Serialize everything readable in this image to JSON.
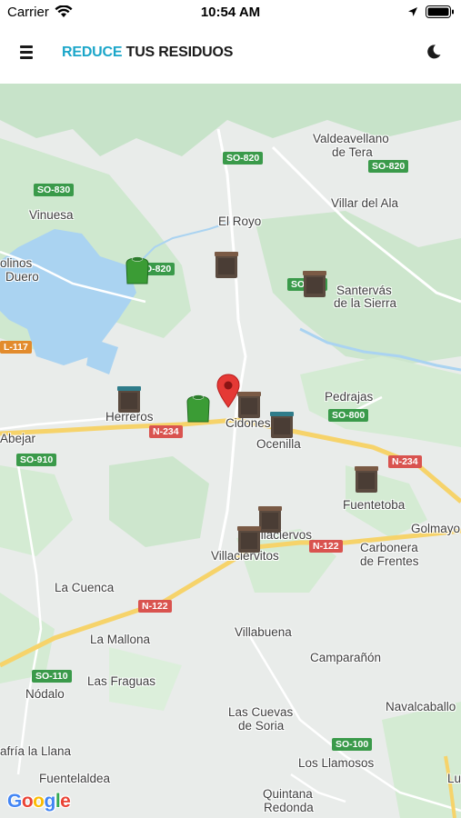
{
  "status_bar": {
    "carrier": "Carrier",
    "time": "10:54 AM",
    "icons": [
      "wifi-icon",
      "location-arrow-icon",
      "battery-icon"
    ]
  },
  "header": {
    "title_accent": "REDUCE",
    "title_main": "TUS RESIDUOS",
    "menu_icon": "hamburger-menu-icon",
    "theme_icon": "moon-icon",
    "accent_color": "#1ba6c9"
  },
  "map": {
    "places": [
      "Valdeavellano",
      "de Tera",
      "Vinuesa",
      "El Royo",
      "Villar del Ala",
      "olinos",
      "Duero",
      "Santervás",
      "de la Sierra",
      "Pedrajas",
      "Herreros",
      "Cidones",
      "Ocenilla",
      "Abejar",
      "Fuentetoba",
      "Golmayo",
      "Villaciervos",
      "Villaciervitos",
      "Carbonera",
      "de Frentes",
      "La Cuenca",
      "La Mallona",
      "Villabuena",
      "Camparañón",
      "Las Fraguas",
      "Nódalo",
      "Navalcaballo",
      "Las Cuevas",
      "de Soria",
      "afría la Llana",
      "Los Llamosos",
      "Fuentelaldea",
      "Quintana",
      "Redonda",
      "Lu"
    ],
    "roads": [
      "SO-820",
      "SO-820",
      "SO-830",
      "SO-820",
      "SO-820",
      "L-117",
      "N-234",
      "SO-800",
      "N-234",
      "SO-910",
      "N-122",
      "N-122",
      "SO-110",
      "SO-100"
    ],
    "markers": [
      {
        "type": "green-container-icon"
      },
      {
        "type": "brown-container-icon"
      },
      {
        "type": "brown-container-icon"
      },
      {
        "type": "brown-container-icon"
      },
      {
        "type": "green-container-icon"
      },
      {
        "type": "brown-container-icon"
      },
      {
        "type": "brown-container-icon"
      },
      {
        "type": "brown-container-icon"
      },
      {
        "type": "brown-container-icon"
      },
      {
        "type": "brown-container-icon"
      },
      {
        "type": "location-pin-icon"
      }
    ],
    "attribution": {
      "g1": "G",
      "o1": "o",
      "o2": "o",
      "g2": "g",
      "l": "l",
      "e": "e"
    }
  }
}
